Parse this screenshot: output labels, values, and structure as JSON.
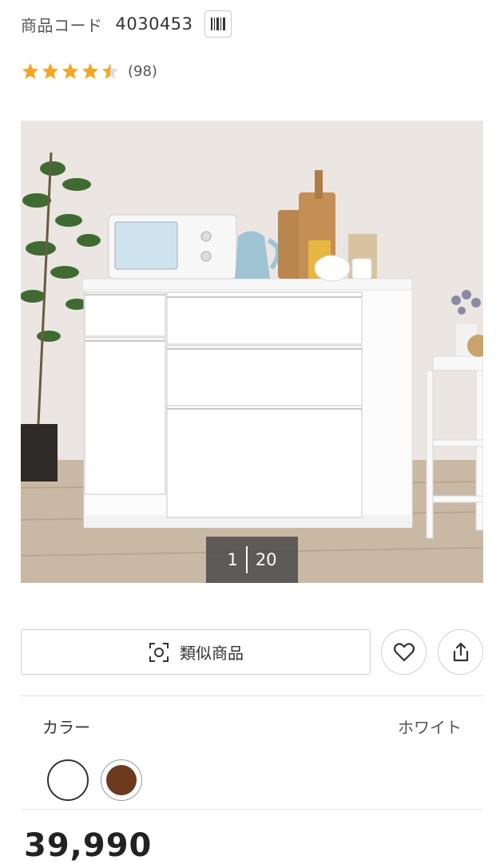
{
  "product": {
    "code_label": "商品コード",
    "code_value": "4030453",
    "rating": 4.5,
    "review_count": "(98)",
    "star_color": "#f5a623"
  },
  "gallery": {
    "current": "1",
    "total": "20"
  },
  "actions": {
    "similar_label": "類似商品"
  },
  "color": {
    "label": "カラー",
    "selected": "ホワイト",
    "options_colors": [
      "#ffffff",
      "#6b3a1f"
    ]
  },
  "price": {
    "text": "39,990"
  }
}
